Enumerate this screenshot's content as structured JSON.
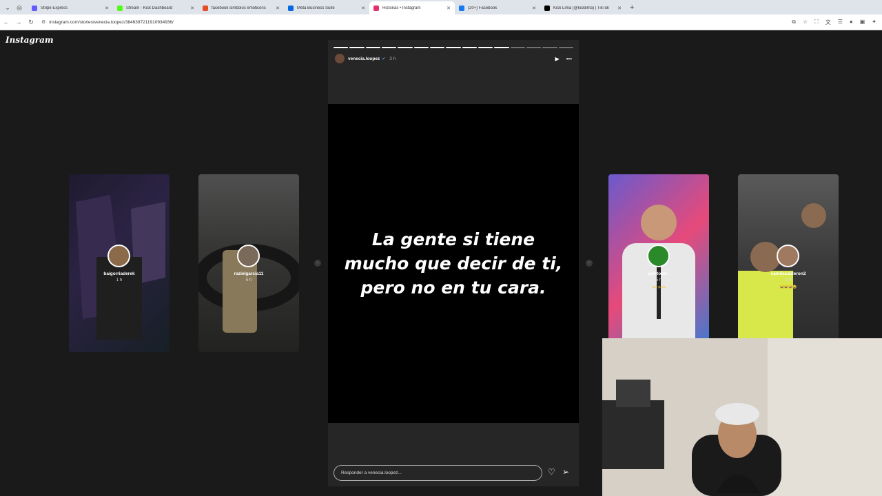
{
  "browser": {
    "tabs": [
      {
        "label": "Stripe Express",
        "color": "#635bff"
      },
      {
        "label": "Stream - Kick Dashboard",
        "color": "#53fc18"
      },
      {
        "label": "facebook simbolos emoticons",
        "color": "#e34c26"
      },
      {
        "label": "Meta Business Suite",
        "color": "#0668e1"
      },
      {
        "label": "Historias • Instagram",
        "color": "#e1306c"
      },
      {
        "label": "(20+) Facebook",
        "color": "#1877f2"
      },
      {
        "label": "Kick Lima (@kicklima) | TikTok",
        "color": "#000000"
      }
    ],
    "active_tab": 4,
    "url": "instagram.com/stories/venecia.loopez/3846397211910934936/"
  },
  "instagram": {
    "logo": "Instagram",
    "left_stories": [
      {
        "username": "baigorriaderek",
        "time": "1 h"
      },
      {
        "username": "razielgarcia11",
        "time": "5 h"
      }
    ],
    "right_stories": [
      {
        "username": "carlitostv_",
        "time": "5 h",
        "label": "que paso"
      },
      {
        "username": "camilacalderon2",
        "time": "9 h",
        "label": "😂😂😂😂"
      }
    ],
    "story": {
      "username": "venecia.loopez",
      "time": "3 h",
      "text": "La gente si tiene mucho que decir de ti, pero no en tu cara.",
      "reply_placeholder": "Responder a venecia.loopez...",
      "segments_total": 15,
      "segments_done": 11
    }
  },
  "colors": {
    "background": "#1a1a1a",
    "story_bg": "#262626",
    "accent": "#e1306c"
  }
}
